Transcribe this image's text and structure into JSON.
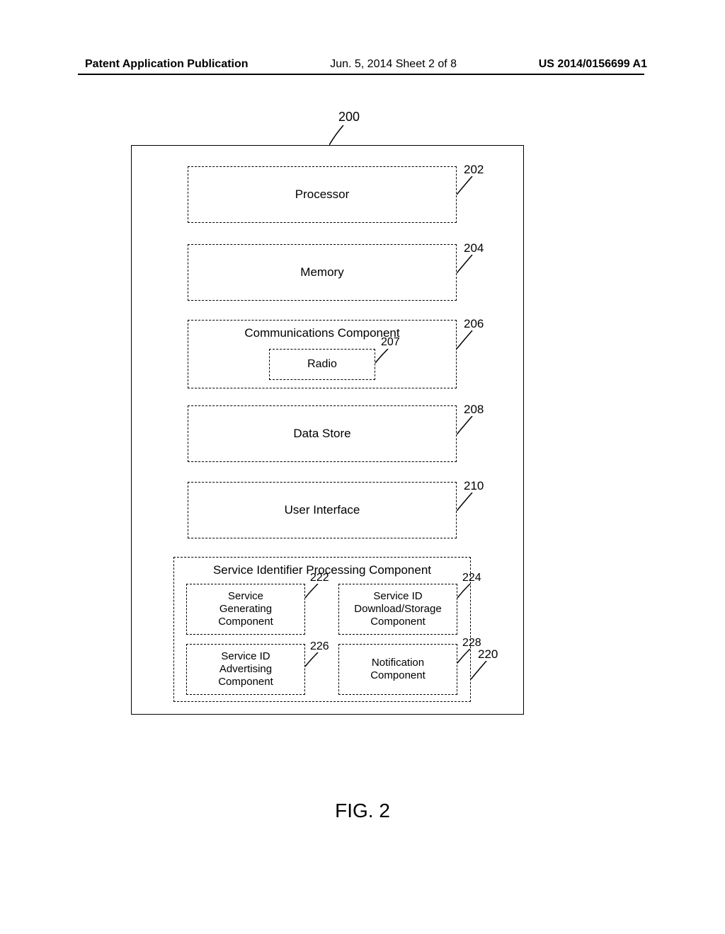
{
  "header": {
    "left": "Patent Application Publication",
    "center": "Jun. 5, 2014  Sheet 2 of 8",
    "right": "US 2014/0156699 A1"
  },
  "figure_caption": "FIG. 2",
  "refs": {
    "r200": "200",
    "r202": "202",
    "r204": "204",
    "r206": "206",
    "r207": "207",
    "r208": "208",
    "r210": "210",
    "r220": "220",
    "r222": "222",
    "r224": "224",
    "r226": "226",
    "r228": "228"
  },
  "boxes": {
    "processor": "Processor",
    "memory": "Memory",
    "comm": "Communications Component",
    "radio": "Radio",
    "datastore": "Data Store",
    "ui": "User Interface",
    "sip": "Service Identifier Processing Component",
    "sg1": "Service",
    "sg2": "Generating",
    "sg3": "Component",
    "dls1": "Service ID",
    "dls2": "Download/Storage",
    "dls3": "Component",
    "adv1": "Service ID",
    "adv2": "Advertising",
    "adv3": "Component",
    "not1": "Notification",
    "not2": "Component"
  }
}
